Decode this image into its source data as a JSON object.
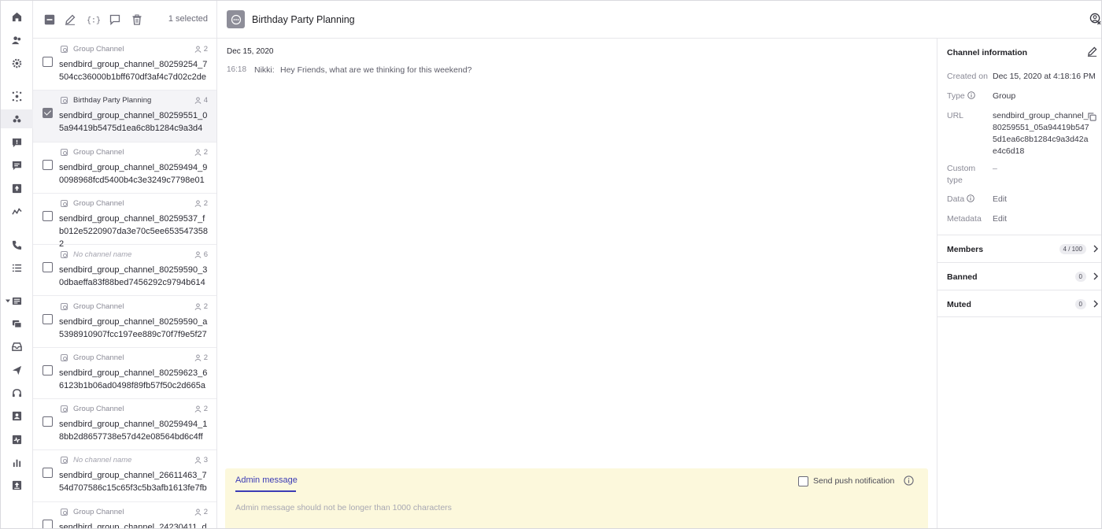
{
  "toolbar": {
    "selected_text": "1 selected"
  },
  "channels": [
    {
      "name": "Group Channel",
      "members": "2",
      "url": "sendbird_group_channel_80259254_7504cc36000b1bff670df3af4c7d02c2de",
      "checked": false,
      "style": "normal"
    },
    {
      "name": "Birthday Party Planning",
      "members": "4",
      "url": "sendbird_group_channel_80259551_05a94419b5475d1ea6c8b1284c9a3d4",
      "checked": true,
      "style": "dark"
    },
    {
      "name": "Group Channel",
      "members": "2",
      "url": "sendbird_group_channel_80259494_90098968fcd5400b4c3e3249c7798e01",
      "checked": false,
      "style": "normal"
    },
    {
      "name": "Group Channel",
      "members": "2",
      "url": "sendbird_group_channel_80259537_fb012e5220907da3e70c5ee6535473582",
      "checked": false,
      "style": "normal"
    },
    {
      "name": "No channel name",
      "members": "6",
      "url": "sendbird_group_channel_80259590_30dbaeffa83f88bed7456292c9794b614",
      "checked": false,
      "style": "italic"
    },
    {
      "name": "Group Channel",
      "members": "2",
      "url": "sendbird_group_channel_80259590_a5398910907fcc197ee889c70f7f9e5f27",
      "checked": false,
      "style": "normal"
    },
    {
      "name": "Group Channel",
      "members": "2",
      "url": "sendbird_group_channel_80259623_66123b1b06ad0498f89fb57f50c2d665a",
      "checked": false,
      "style": "normal"
    },
    {
      "name": "Group Channel",
      "members": "2",
      "url": "sendbird_group_channel_80259494_18bb2d8657738e57d42e08564bd6c4ff",
      "checked": false,
      "style": "normal"
    },
    {
      "name": "No channel name",
      "members": "3",
      "url": "sendbird_group_channel_26611463_754d707586c15c65f3c5b3afb1613fe7fb",
      "checked": false,
      "style": "italic"
    },
    {
      "name": "Group Channel",
      "members": "2",
      "url": "sendbird_group_channel_24230411_d",
      "checked": false,
      "style": "normal"
    }
  ],
  "header": {
    "title": "Birthday Party Planning"
  },
  "chat": {
    "date": "Dec 15, 2020",
    "messages": [
      {
        "time": "16:18",
        "sender": "Nikki:",
        "text": "Hey Friends, what are we thinking for this weekend?"
      }
    ]
  },
  "admin": {
    "tab_label": "Admin message",
    "push_label": "Send push notification",
    "placeholder": "Admin message should not be longer than 1000 characters"
  },
  "info": {
    "title": "Channel information",
    "created_label": "Created on",
    "created_value": "Dec 15, 2020 at 4:18:16 PM",
    "type_label": "Type",
    "type_value": "Group",
    "url_label": "URL",
    "url_value": "sendbird_group_channel_80259551_05a94419b5475d1ea6c8b1284c9a3d42ae4c6d18",
    "custom_label": "Custom type",
    "custom_value": "–",
    "data_label": "Data",
    "data_value": "Edit",
    "metadata_label": "Metadata",
    "metadata_value": "Edit",
    "sections": [
      {
        "label": "Members",
        "badge": "4 / 100"
      },
      {
        "label": "Banned",
        "badge": "0"
      },
      {
        "label": "Muted",
        "badge": "0"
      }
    ]
  }
}
